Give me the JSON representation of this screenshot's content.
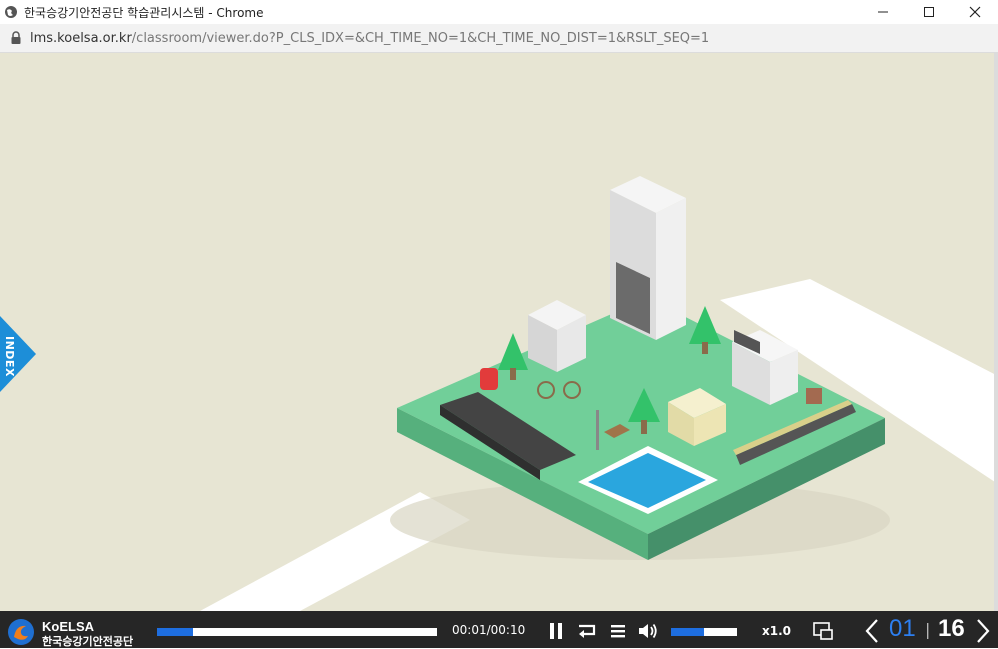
{
  "window": {
    "title": "한국승강기안전공단 학습관리시스템 - Chrome"
  },
  "address": {
    "host": "lms.koelsa.or.kr",
    "path": "/classroom/viewer.do?P_CLS_IDX=&CH_TIME_NO=1&CH_TIME_NO_DIST=1&RSLT_SEQ=1"
  },
  "sidebar": {
    "index_label": "INDEX"
  },
  "logo": {
    "en": "KoELSA",
    "kr": "한국승강기안전공단"
  },
  "player": {
    "time": "00:01/00:10",
    "progress": 0.13,
    "volume": 0.5,
    "speed": "x1.0",
    "page_current": "01",
    "page_sep": "|",
    "page_total": "16"
  },
  "colors": {
    "accent": "#1e6ee0",
    "page_current": "#2d7ff0",
    "stage_bg": "#e7e5d3",
    "island_top": "#6fcf97",
    "pool": "#29a9e0",
    "bar_bg": "#262626"
  },
  "icons": [
    "globe-icon",
    "minimize-icon",
    "maximize-icon",
    "close-icon",
    "lock-icon",
    "pause-icon",
    "repeat-icon",
    "menu-icon",
    "volume-icon",
    "screen-icon",
    "prev-page-icon",
    "next-page-icon"
  ]
}
